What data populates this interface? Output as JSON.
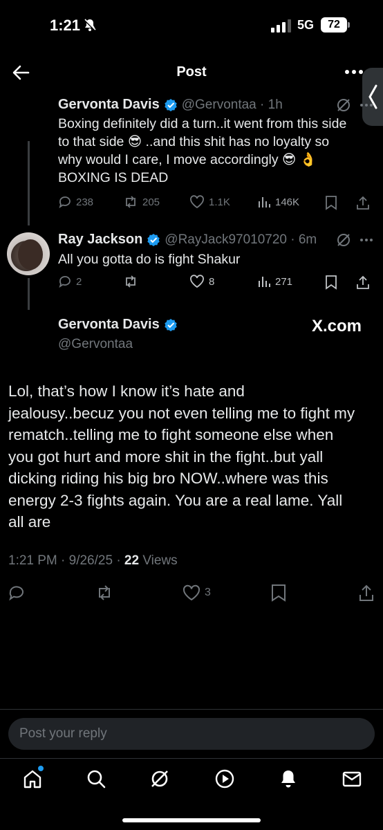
{
  "status_bar": {
    "time": "1:21",
    "network": "5G",
    "battery": "72"
  },
  "header": {
    "title": "Post"
  },
  "tweets": [
    {
      "name": "Gervonta Davis",
      "handle": "@Gervontaa · 1h",
      "lines": [
        "Boxing definitely did a turn..it went from this side",
        "to that side 😎 ..and this shit has no loyalty so",
        "why would I care, I move accordingly 😎 👌",
        "BOXING IS DEAD"
      ],
      "stats": {
        "replies": "238",
        "reposts": "205",
        "likes": "1.1K",
        "views": "146K"
      }
    },
    {
      "name": "Ray Jackson",
      "handle": "@RayJack97010720 · 6m",
      "lines": [
        "All you gotta do is fight Shakur"
      ],
      "stats": {
        "replies": "2",
        "reposts": "",
        "likes": "8",
        "views": "271"
      }
    }
  ],
  "main_tweet": {
    "name": "Gervonta Davis",
    "handle": "@Gervontaa",
    "watermark": "X.com",
    "text_lines": [
      "Lol, that’s how I know it’s hate and",
      "jealousy..becuz you not even telling me to fight my",
      "rematch..telling me to fight someone else when",
      "you got hurt and more shit in the fight..but yall",
      "dicking riding his big bro NOW..where was this",
      "energy 2-3 fights again. You are a real lame. Yall",
      "all are"
    ],
    "timestamp": "1:21 PM · 9/26/25 · ",
    "views_count": "22",
    "views_label": " Views",
    "likes": "3"
  },
  "reply_box": {
    "placeholder": "Post your reply"
  },
  "colors": {
    "background": "#000000",
    "text": "#e7e9ea",
    "muted": "#71767b",
    "accent": "#1d9bf0"
  }
}
